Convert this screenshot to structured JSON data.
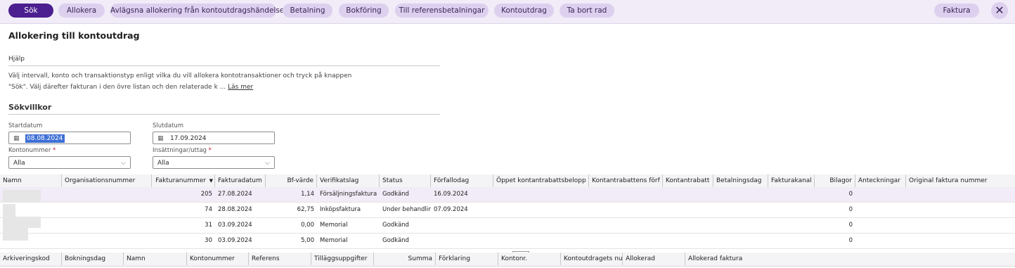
{
  "toolbar": {
    "buttons": [
      "Sök",
      "Allokera",
      "Avlägsna allokering från kontoutdragshändelse",
      "Betalning",
      "Bokföring",
      "Till referensbetalningar",
      "Kontoutdrag",
      "Ta bort rad",
      "Faktura"
    ],
    "close_icon": "close-icon"
  },
  "page": {
    "title": "Allokering till kontoutdrag",
    "help_heading": "Hjälp",
    "help_line1": "Välj intervall, konto och transaktionstyp enligt vilka du vill allokera kontotransaktioner och tryck på knappen",
    "help_line2": "\"Sök\". Välj därefter fakturan i den övre listan och den relaterade k ...",
    "read_more": "Läs mer",
    "search_heading": "Sökvillkor"
  },
  "form": {
    "start_label": "Startdatum",
    "start_value": "08.08.2024",
    "end_label": "Slutdatum",
    "end_value": "17.09.2024",
    "account_label": "Kontonummer",
    "account_value": "Alla",
    "inout_label": "Insättningar/uttag",
    "inout_value": "Alla",
    "required_mark": "*"
  },
  "invoice_table": {
    "columns": [
      "Namn",
      "Organisationsnummer",
      "Fakturanummer",
      "Fakturadatum",
      "Bf-värde",
      "Verifikatslag",
      "Status",
      "Förfallodag",
      "Öppet kontantrabattsbelopp",
      "Kontantrabattens förf",
      "Kontantrabatt",
      "Betalningsdag",
      "Fakturakanal",
      "Bilagor",
      "Anteckningar",
      "Original faktura nummer"
    ],
    "sort_icon": "sort-desc-icon",
    "rows": [
      {
        "nr": "205",
        "date": "27.08.2024",
        "value": "1,14",
        "type": "Försäljningsfaktura",
        "status": "Godkänd",
        "due": "16.09.2024",
        "att": "0"
      },
      {
        "nr": "74",
        "date": "28.08.2024",
        "value": "62,75",
        "type": "Inköpsfaktura",
        "status": "Under behandling",
        "due": "07.09.2024",
        "att": "0"
      },
      {
        "nr": "31",
        "date": "03.09.2024",
        "value": "0,00",
        "type": "Memorial",
        "status": "Godkänd",
        "due": "",
        "att": "0"
      },
      {
        "nr": "30",
        "date": "03.09.2024",
        "value": "5,00",
        "type": "Memorial",
        "status": "Godkänd",
        "due": "",
        "att": "0"
      }
    ]
  },
  "statement_table": {
    "columns": [
      "Arkiveringskod",
      "Bokningsdag",
      "Namn",
      "Kontonummer",
      "Referens",
      "Tilläggsuppgifter",
      "Summa",
      "Förklaring",
      "Kontonr.",
      "Kontoutdragets nu",
      "Allokerad",
      "Allokerad faktura"
    ]
  },
  "colors": {
    "primary": "#4b1f8f",
    "button": "#ddd0ef",
    "toolbar_bg": "#f1ecf7",
    "selected_row": "#f1ecf7"
  }
}
